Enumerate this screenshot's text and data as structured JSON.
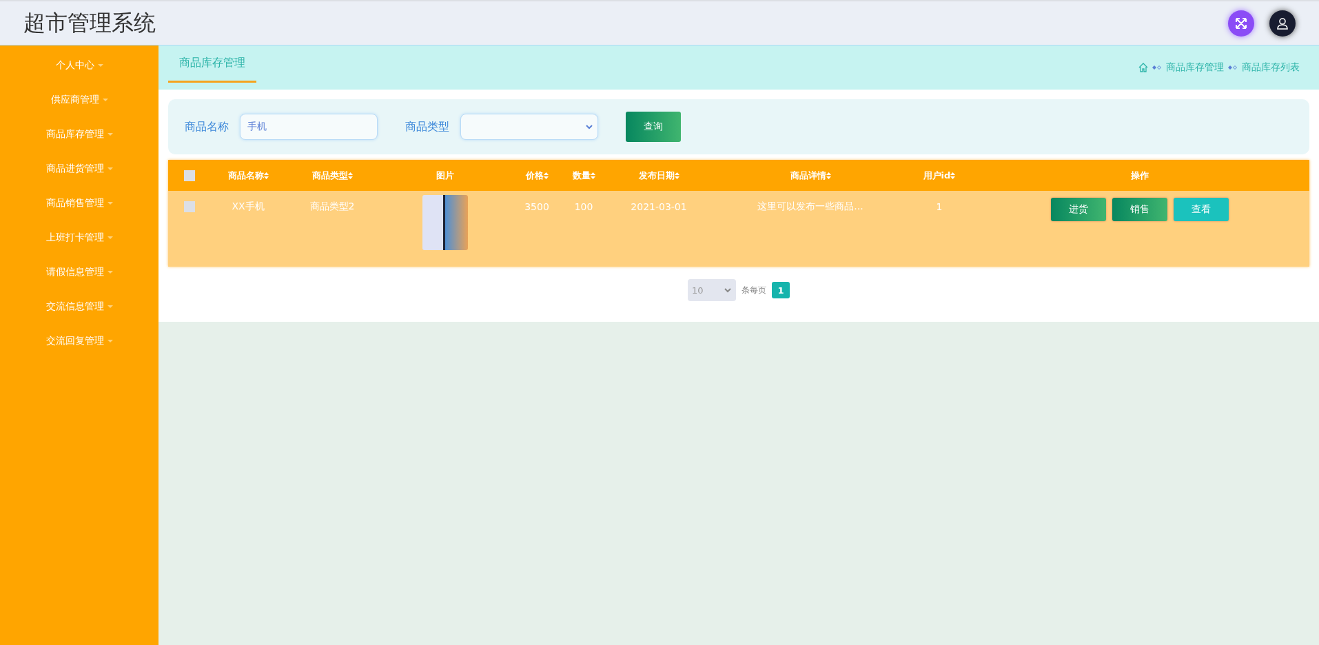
{
  "header": {
    "title": "超市管理系统"
  },
  "sidebar": {
    "items": [
      {
        "label": "个人中心"
      },
      {
        "label": "供应商管理"
      },
      {
        "label": "商品库存管理"
      },
      {
        "label": "商品进货管理"
      },
      {
        "label": "商品销售管理"
      },
      {
        "label": "上班打卡管理"
      },
      {
        "label": "请假信息管理"
      },
      {
        "label": "交流信息管理"
      },
      {
        "label": "交流回复管理"
      }
    ]
  },
  "tabs": [
    {
      "label": "商品库存管理",
      "selected": true
    }
  ],
  "breadcrumb": [
    "商品库存管理",
    "商品库存列表"
  ],
  "search": {
    "fields": [
      {
        "kind": "input",
        "label": "商品名称",
        "value": "手机"
      },
      {
        "kind": "select",
        "label": "商品类型"
      }
    ],
    "button": "查询"
  },
  "table": {
    "select_all_checked": false,
    "columns": [
      {
        "label": "商品名称",
        "sortable": true
      },
      {
        "label": "商品类型",
        "sortable": true
      },
      {
        "label": "图片",
        "sortable": false
      },
      {
        "label": "价格",
        "sortable": true
      },
      {
        "label": "数量",
        "sortable": true
      },
      {
        "label": "发布日期",
        "sortable": true
      },
      {
        "label": "商品详情",
        "sortable": true
      },
      {
        "label": "用户id",
        "sortable": true
      },
      {
        "label": "操作",
        "sortable": false
      }
    ],
    "rows": [
      {
        "checked": false,
        "cells": [
          "XX手机",
          "商品类型2",
          null,
          "3500",
          "100",
          "2021-03-01",
          "这里可以发布一些商品...",
          "1"
        ],
        "actions": [
          {
            "label": "进货",
            "kind": "green"
          },
          {
            "label": "销售",
            "kind": "green"
          },
          {
            "label": "查看",
            "kind": "teal"
          }
        ]
      }
    ]
  },
  "pagination": {
    "page_size": "10",
    "per_page_label": "条每页",
    "pages": [
      {
        "label": "1",
        "selected": true
      }
    ]
  }
}
